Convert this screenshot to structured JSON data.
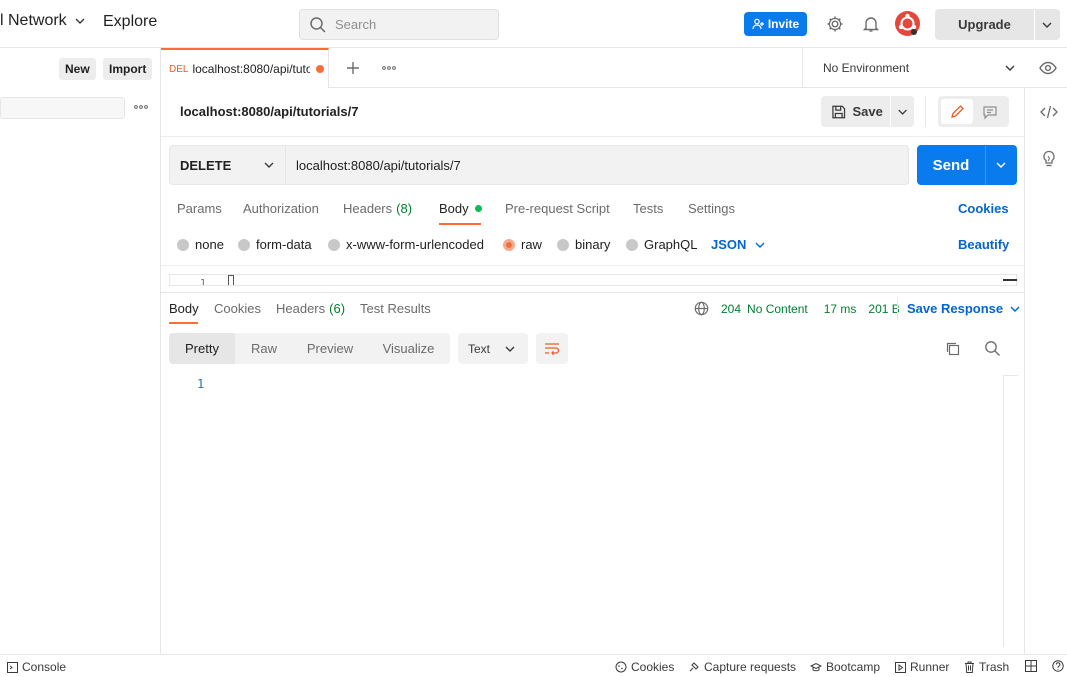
{
  "header": {
    "workspace_label": "l Network",
    "explore_label": "Explore",
    "search_placeholder": "Search",
    "invite_label": "Invite",
    "upgrade_label": "Upgrade"
  },
  "sidebar": {
    "new_label": "New",
    "import_label": "Import"
  },
  "tabs": {
    "active_method": "DEL",
    "active_title": "localhost:8080/api/tutorials/7",
    "environment": "No Environment"
  },
  "request": {
    "title": "localhost:8080/api/tutorials/7",
    "save_label": "Save",
    "method": "DELETE",
    "url": "localhost:8080/api/tutorials/7",
    "send_label": "Send",
    "tabs": [
      {
        "label": "Params"
      },
      {
        "label": "Authorization"
      },
      {
        "label": "Headers",
        "count": "(8)"
      },
      {
        "label": "Body"
      },
      {
        "label": "Pre-request Script"
      },
      {
        "label": "Tests"
      },
      {
        "label": "Settings"
      }
    ],
    "cookies_label": "Cookies",
    "body_types": [
      "none",
      "form-data",
      "x-www-form-urlencoded",
      "raw",
      "binary",
      "GraphQL"
    ],
    "selected_body_type": "raw",
    "format": "JSON",
    "beautify_label": "Beautify",
    "editor_line": "1"
  },
  "response": {
    "tabs": [
      {
        "label": "Body"
      },
      {
        "label": "Cookies"
      },
      {
        "label": "Headers",
        "count": "(6)"
      },
      {
        "label": "Test Results"
      }
    ],
    "status_code": "204",
    "status_text": "No Content",
    "time": "17 ms",
    "size": "201 B",
    "save_response_label": "Save Response",
    "view_modes": [
      "Pretty",
      "Raw",
      "Preview",
      "Visualize"
    ],
    "text_format": "Text",
    "line_number": "1"
  },
  "footer": {
    "console": "Console",
    "cookies": "Cookies",
    "capture": "Capture requests",
    "bootcamp": "Bootcamp",
    "runner": "Runner",
    "trash": "Trash"
  },
  "colors": {
    "accent": "#ff6c37",
    "primary": "#097bed",
    "link": "#0265d2",
    "success": "#007f31"
  }
}
